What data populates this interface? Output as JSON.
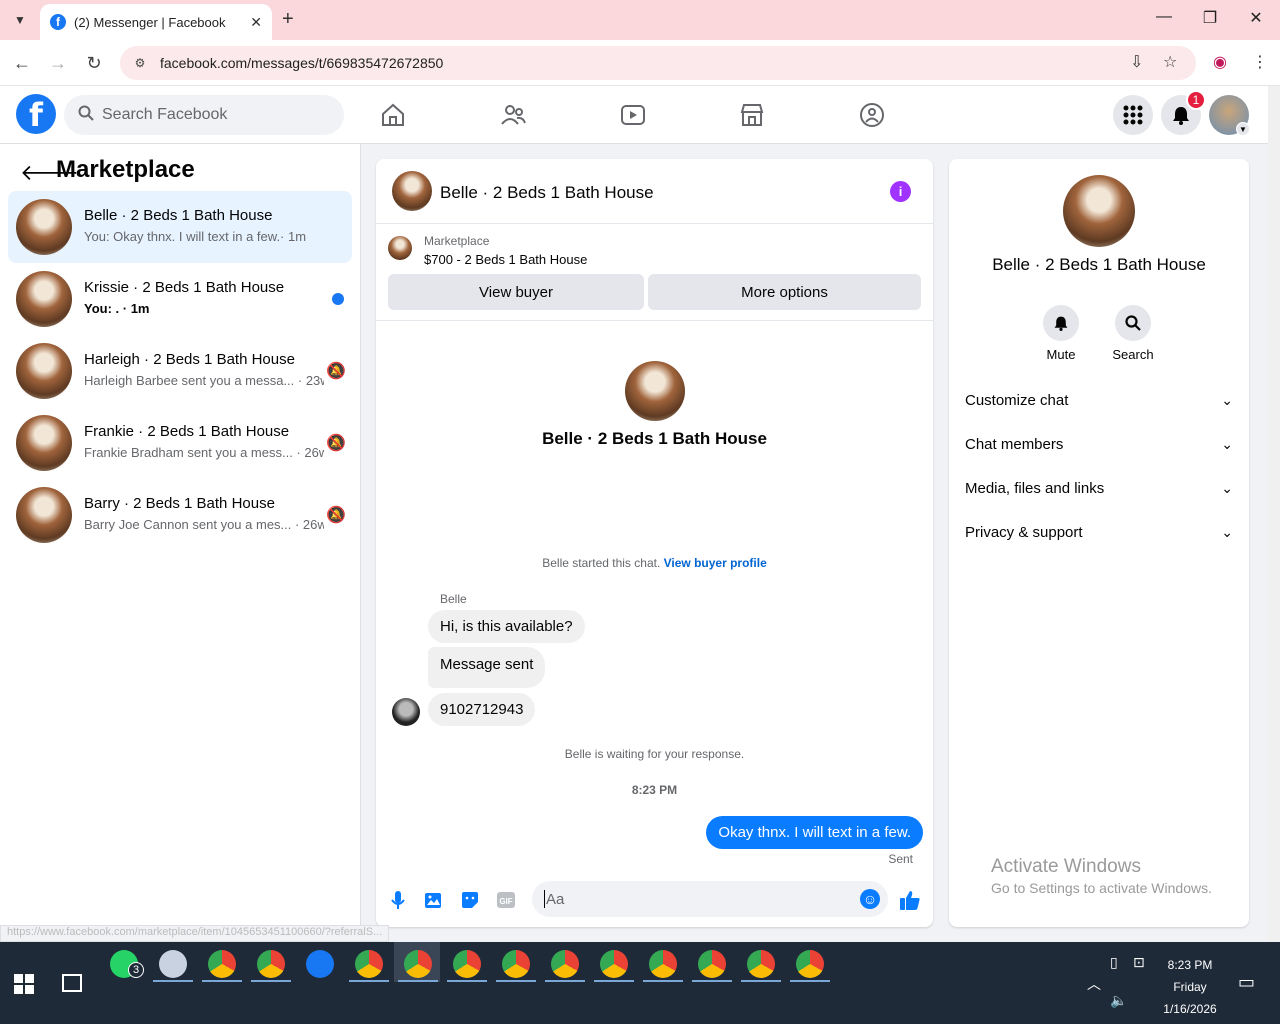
{
  "browser": {
    "tab_title": "(2) Messenger | Facebook",
    "url": "facebook.com/messages/t/669835472672850",
    "status_url": "https://www.facebook.com/marketplace/item/1045653451100660/?referralS..."
  },
  "fb": {
    "search_placeholder": "Search Facebook",
    "notification_count": "1"
  },
  "sidebar": {
    "title": "Marketplace",
    "conversations": [
      {
        "name": "Belle · 2 Beds 1 Bath House",
        "preview": "You: Okay thnx. I will text in a few.· 1m",
        "active": true
      },
      {
        "name": "Krissie · 2 Beds 1 Bath House",
        "preview": "You: . · 1m",
        "unread": true
      },
      {
        "name": "Harleigh · 2 Beds 1 Bath House",
        "preview": "Harleigh Barbee sent you a messa... · 23w",
        "muted": true
      },
      {
        "name": "Frankie · 2 Beds 1 Bath House",
        "preview": "Frankie Bradham sent you a mess... · 26w",
        "muted": true
      },
      {
        "name": "Barry · 2 Beds 1 Bath House",
        "preview": "Barry Joe Cannon sent you a mes... · 26w",
        "muted": true
      }
    ]
  },
  "chat": {
    "title": "Belle · 2 Beds 1 Bath House",
    "listing_label": "Marketplace",
    "listing_price": "$700 - 2 Beds 1 Bath House",
    "view_buyer": "View buyer",
    "more_options": "More options",
    "center_name": "Belle · 2 Beds 1 Bath House",
    "started_text": "Belle started this chat.",
    "view_buyer_profile": "View buyer profile",
    "sender": "Belle",
    "incoming": [
      "Hi, is this available?",
      "Message sent",
      "9102712943"
    ],
    "waiting": "Belle is waiting for your response.",
    "time": "8:23 PM",
    "outgoing": "Okay thnx. I will text in a few.",
    "sent": "Sent",
    "composer_placeholder": "Aa"
  },
  "details": {
    "name": "Belle · 2 Beds 1 Bath House",
    "mute": "Mute",
    "search": "Search",
    "rows": [
      "Customize chat",
      "Chat members",
      "Media, files and links",
      "Privacy & support"
    ]
  },
  "watermark": {
    "line1": "Activate Windows",
    "line2": "Go to Settings to activate Windows."
  },
  "taskbar": {
    "whatsapp_badge": "3",
    "time": "8:23 PM",
    "day": "Friday",
    "date": "1/16/2026"
  },
  "colors": {
    "fb_blue": "#1877f2",
    "messenger_blue": "#0a7cff",
    "tab_bg": "#fbd8dc"
  }
}
